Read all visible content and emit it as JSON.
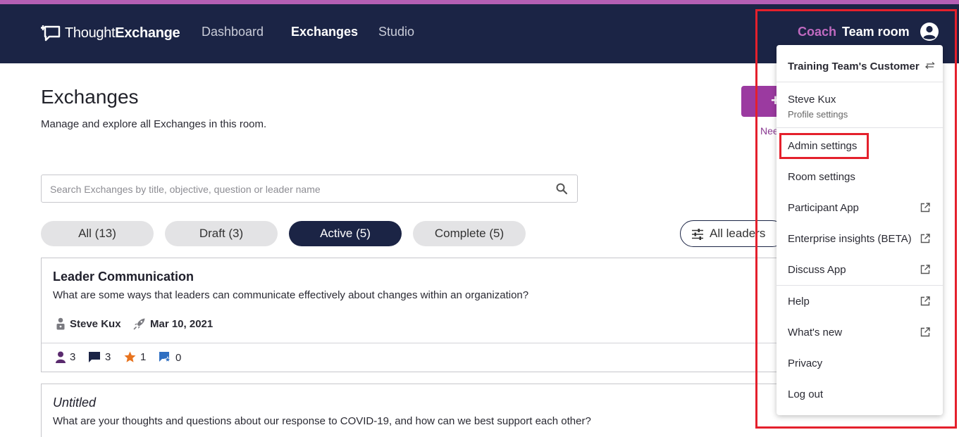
{
  "colors": {
    "navbar": "#1b2445",
    "accent": "#9b3aa0",
    "coach": "#c06ac0",
    "highlight": "#e4202c"
  },
  "header": {
    "logo_part1": "Thought",
    "logo_part2": "Exchange",
    "nav": [
      "Dashboard",
      "Exchanges",
      "Studio"
    ],
    "coach_label": "Coach",
    "team_room_label": "Team room"
  },
  "main": {
    "title": "Exchanges",
    "subtitle": "Manage and explore all Exchanges in this room.",
    "need_link": "Nee",
    "search_placeholder": "Search Exchanges by title, objective, question or leader name",
    "tabs": [
      "All (13)",
      "Draft (3)",
      "Active (5)",
      "Complete (5)"
    ],
    "leaders_filter": "All leaders"
  },
  "cards": [
    {
      "title": "Leader Communication",
      "question": "What are some ways that leaders can communicate effectively about changes within an organization?",
      "leader": "Steve Kux",
      "date": "Mar 10, 2021",
      "participants": "3",
      "thoughts": "3",
      "stars": "1",
      "shared": "0"
    },
    {
      "title": "Untitled",
      "question": "What are your thoughts and questions about our response to COVID-19, and how can we best support each other?"
    }
  ],
  "menu": {
    "room": "Training Team's Customer",
    "user_name": "Steve Kux",
    "profile_settings": "Profile settings",
    "admin_settings": "Admin settings",
    "room_settings": "Room settings",
    "participant_app": "Participant App",
    "enterprise_insights": "Enterprise insights (BETA)",
    "discuss_app": "Discuss App",
    "help": "Help",
    "whats_new": "What's new",
    "privacy": "Privacy",
    "log_out": "Log out"
  }
}
